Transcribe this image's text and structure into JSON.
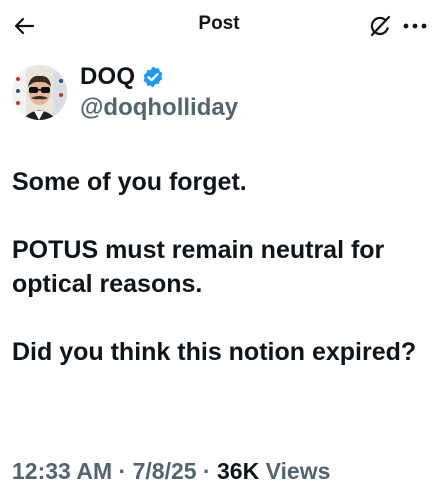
{
  "header": {
    "title": "Post",
    "back_icon": "arrow-left-icon",
    "grok_icon": "grok-icon",
    "more_icon": "more-horizontal-icon"
  },
  "author": {
    "display_name": "DOQ",
    "handle": "@doqholliday",
    "verified_icon": "verified-badge-icon",
    "verified_color": "#1d9bf0"
  },
  "tweet": {
    "paragraphs": [
      "Some of you forget.",
      "POTUS must remain neutral for optical reasons.",
      "Did you think this notion expired?"
    ]
  },
  "meta": {
    "time": "12:33 AM",
    "sep1": " · ",
    "date": "7/8/25",
    "sep2": " · ",
    "views_count": "36K",
    "views_label": " Views"
  },
  "colors": {
    "text": "#0f1419",
    "secondary": "#536471",
    "accent": "#1d9bf0"
  }
}
